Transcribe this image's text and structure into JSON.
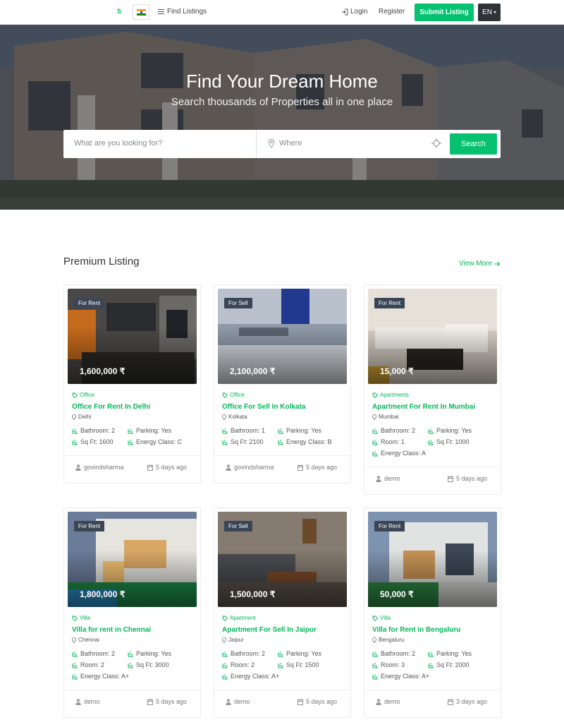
{
  "header": {
    "logo_text": "S",
    "find_listings": "Find Listings",
    "login": "Login",
    "register": "Register",
    "submit_listing": "Submit Listing",
    "language": "EN"
  },
  "hero": {
    "title": "Find Your Dream Home",
    "subtitle": "Search thousands of Properties all in one place",
    "search_placeholder": "What are you looking for?",
    "where_placeholder": "Where",
    "search_button": "Search"
  },
  "section": {
    "title": "Premium Listing",
    "view_more": "View More"
  },
  "colors": {
    "accent": "#06c270",
    "accent_text": "#06b65a",
    "dark": "#2f3338",
    "tag_bg": "#3a4656"
  },
  "listings": [
    {
      "tag": "For Rent",
      "price": "1,600,000 ₹",
      "category": "Office",
      "title": "Office For Rent In Delhi",
      "location": "Delhi",
      "features": [
        "Bathroom: 2",
        "Parking: Yes",
        "Sq Ft: 1600",
        "Energy Class: C"
      ],
      "owner": "govindsharma",
      "date": "5 days ago"
    },
    {
      "tag": "For Sell",
      "price": "2,100,000 ₹",
      "category": "Office",
      "title": "Office For Sell In Kolkata",
      "location": "Kolkata",
      "features": [
        "Bathroom: 1",
        "Parking: Yes",
        "Sq Ft: 2100",
        "Energy Class: B"
      ],
      "owner": "govindsharma",
      "date": "5 days ago"
    },
    {
      "tag": "For Rent",
      "price": "15,000 ₹",
      "category": "Apartments",
      "title": "Apartment For Rent In Mumbai",
      "location": "Mumbai",
      "features": [
        "Bathroom: 2",
        "Parking: Yes",
        "Room: 1",
        "Sq Ft: 1000",
        "Energy Class: A"
      ],
      "owner": "demo",
      "date": "5 days ago"
    },
    {
      "tag": "For Rent",
      "price": "1,800,000 ₹",
      "category": "Villa",
      "title": "Villa for rent in Chennai",
      "location": "Chennai",
      "features": [
        "Bathroom: 2",
        "Parking: Yes",
        "Room: 2",
        "Sq Ft: 3000",
        "Energy Class: A+"
      ],
      "owner": "demo",
      "date": "5 days ago"
    },
    {
      "tag": "For Sell",
      "price": "1,500,000 ₹",
      "category": "Apartment",
      "title": "Apartment For Sell In Jaipur",
      "location": "Jaipur",
      "features": [
        "Bathroom: 2",
        "Parking: Yes",
        "Room: 2",
        "Sq Ft: 1500",
        "Energy Class: A+"
      ],
      "owner": "demo",
      "date": "5 days ago"
    },
    {
      "tag": "For Rent",
      "price": "50,000 ₹",
      "category": "Villa",
      "title": "Villa for Rent in Bengaluru",
      "location": "Bengaluru",
      "features": [
        "Bathroom: 2",
        "Parking: Yes",
        "Room: 3",
        "Sq Ft: 2000",
        "Energy Class: A+"
      ],
      "owner": "demo",
      "date": "3 days ago"
    }
  ]
}
